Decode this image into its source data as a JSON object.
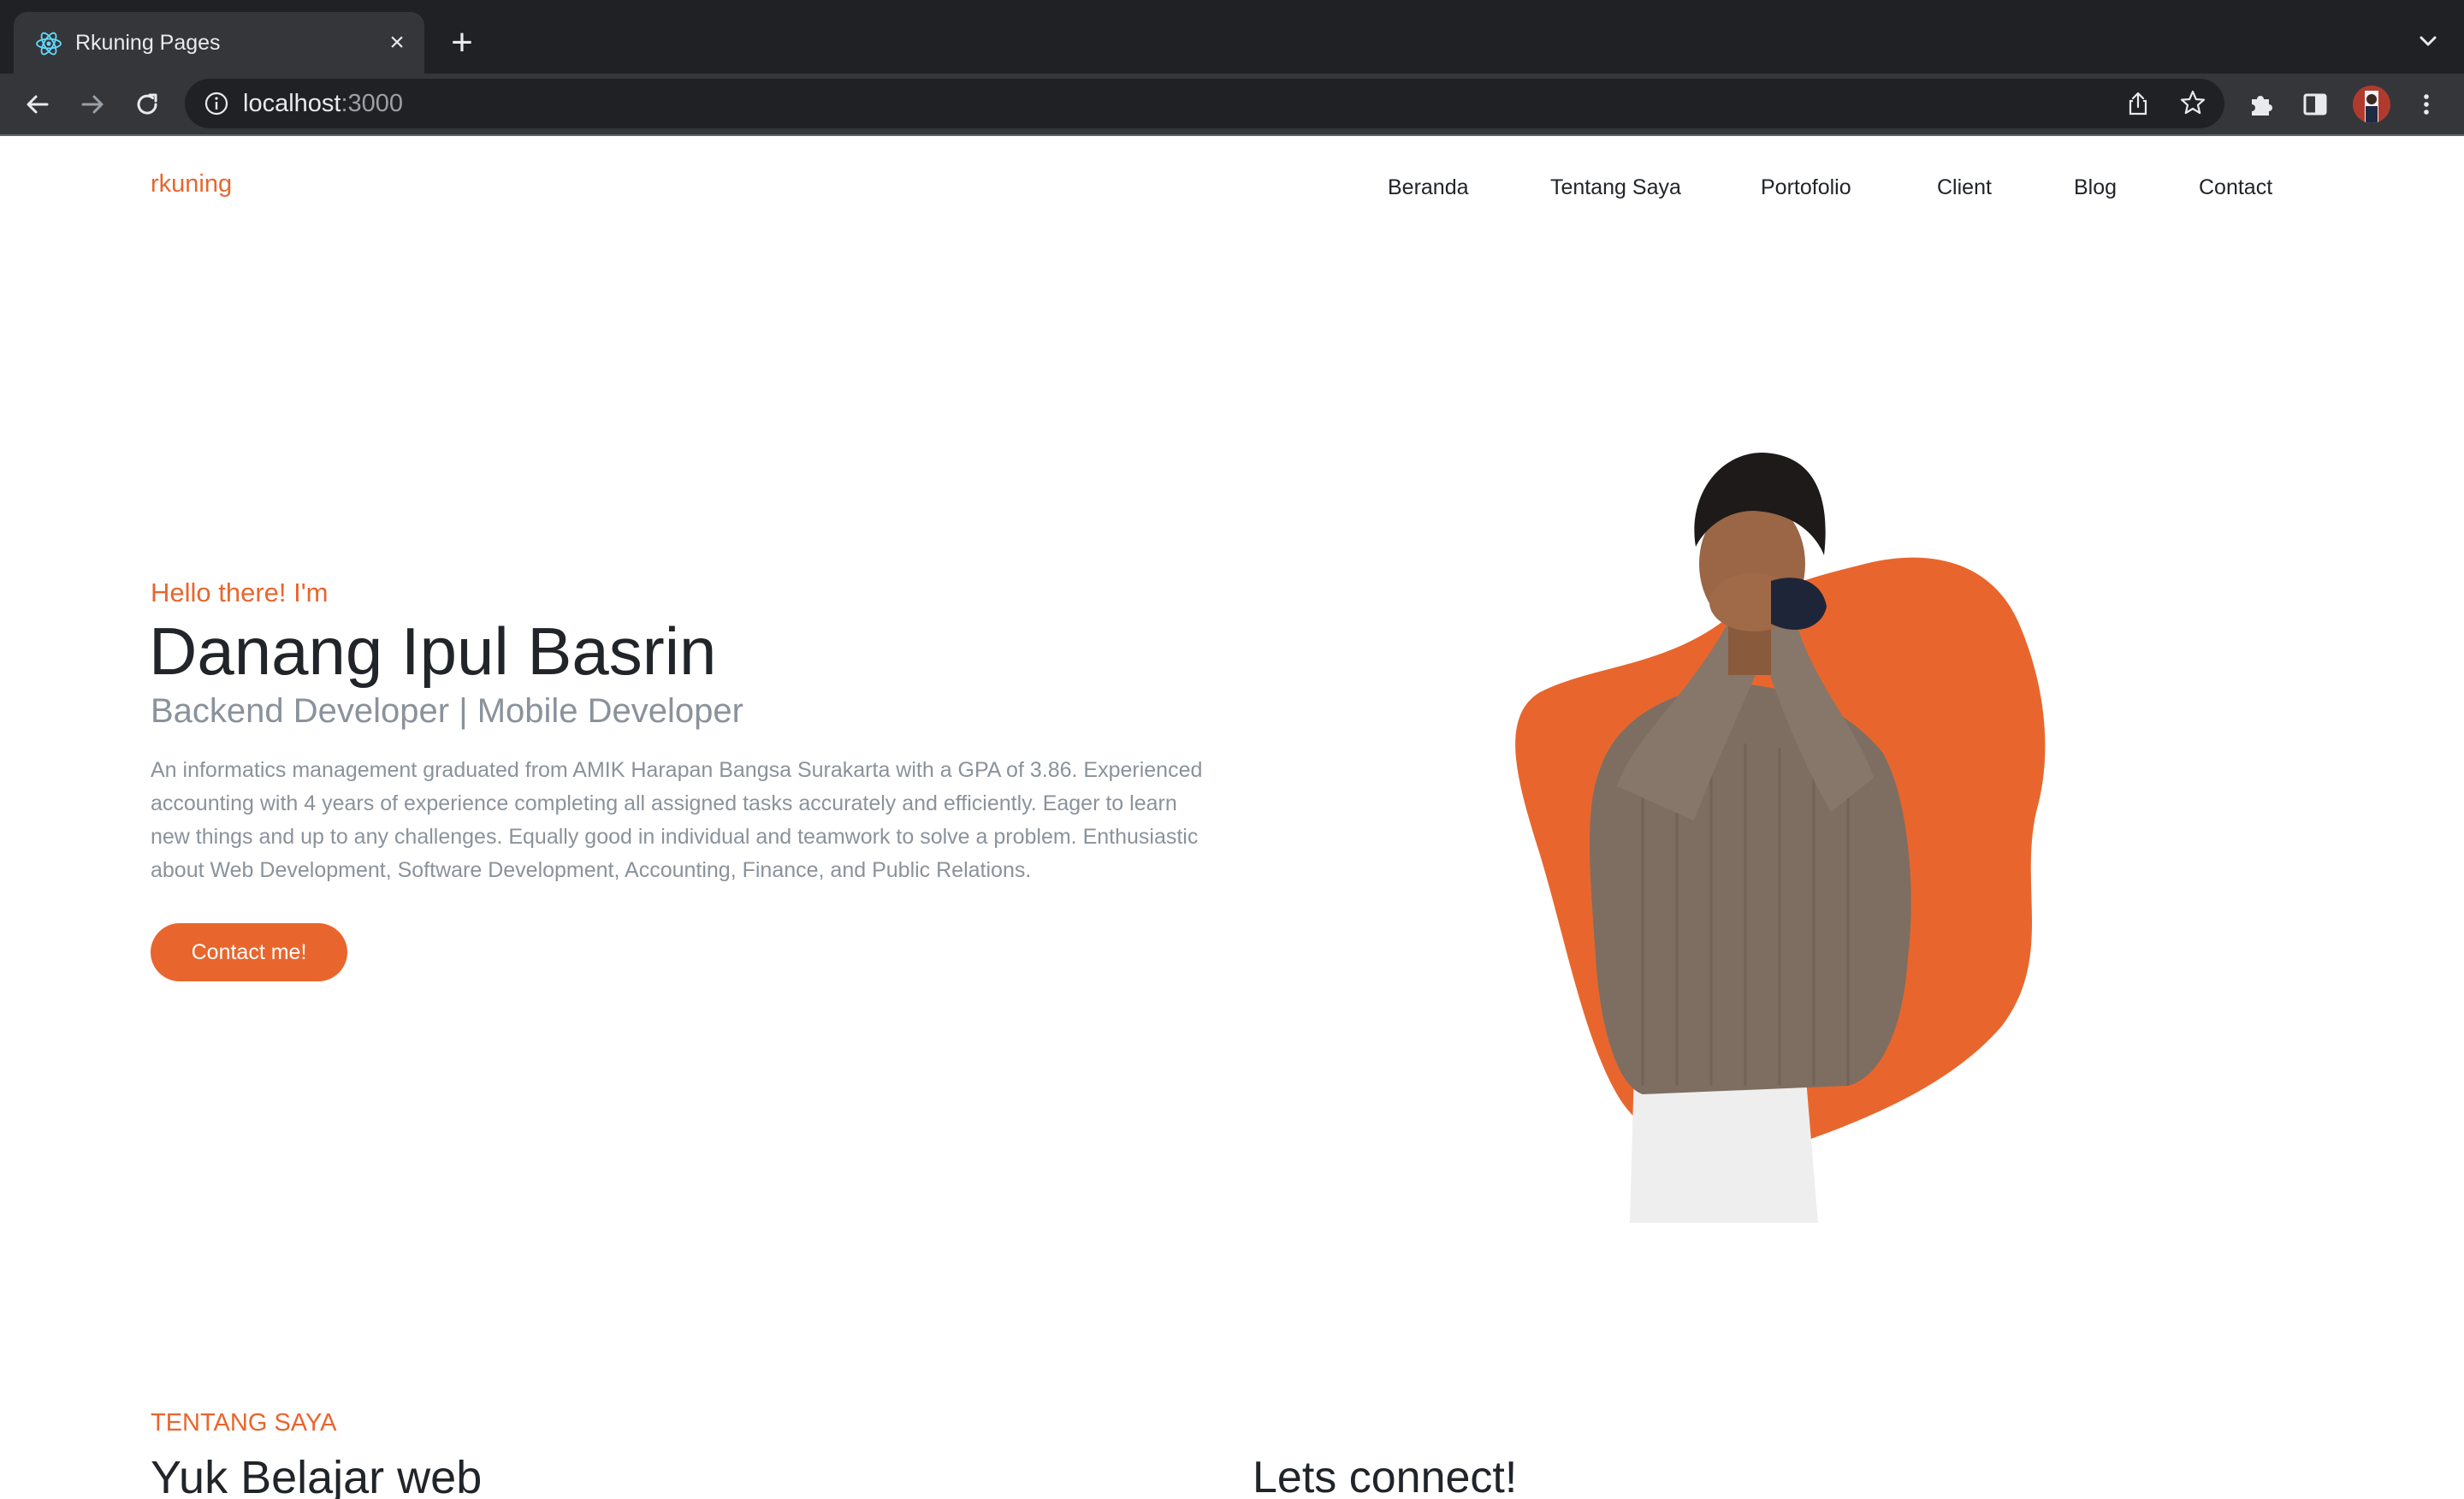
{
  "browser": {
    "tab_title": "Rkuning Pages",
    "tab_close": "×",
    "new_tab": "+",
    "url_host": "localhost",
    "url_port": ":3000"
  },
  "header": {
    "brand": "rkuning",
    "nav": [
      "Beranda",
      "Tentang Saya",
      "Portofolio",
      "Client",
      "Blog",
      "Contact"
    ]
  },
  "hero": {
    "greeting": "Hello there! I'm",
    "name": "Danang Ipul Basrin",
    "role": "Backend Developer | Mobile Developer",
    "bio": "An informatics management graduated from AMIK Harapan Bangsa Surakarta with a GPA of 3.86. Experienced accounting with 4 years of experience completing all assigned tasks accurately and efficiently. Eager to learn new things and up to any challenges. Equally good in individual and teamwork to solve a problem. Enthusiastic about Web Development, Software Development, Accounting, Finance, and Public Relations.",
    "cta_label": "Contact me!"
  },
  "about": {
    "eyebrow": "TENTANG SAYA",
    "title": "Yuk Belajar web",
    "connect_title": "Lets connect!"
  },
  "colors": {
    "accent": "#e8662d",
    "text": "#212529",
    "muted": "#8a929b",
    "chrome_dark": "#202124",
    "chrome_toolbar": "#35363a"
  },
  "icons": {
    "favicon": "react-atom-icon",
    "back": "back-arrow-icon",
    "forward": "forward-arrow-icon",
    "reload": "reload-icon",
    "site_info": "info-icon",
    "share": "share-icon",
    "bookmark": "star-icon",
    "extensions": "puzzle-icon",
    "side_panel": "side-panel-icon",
    "menu": "kebab-menu-icon"
  }
}
